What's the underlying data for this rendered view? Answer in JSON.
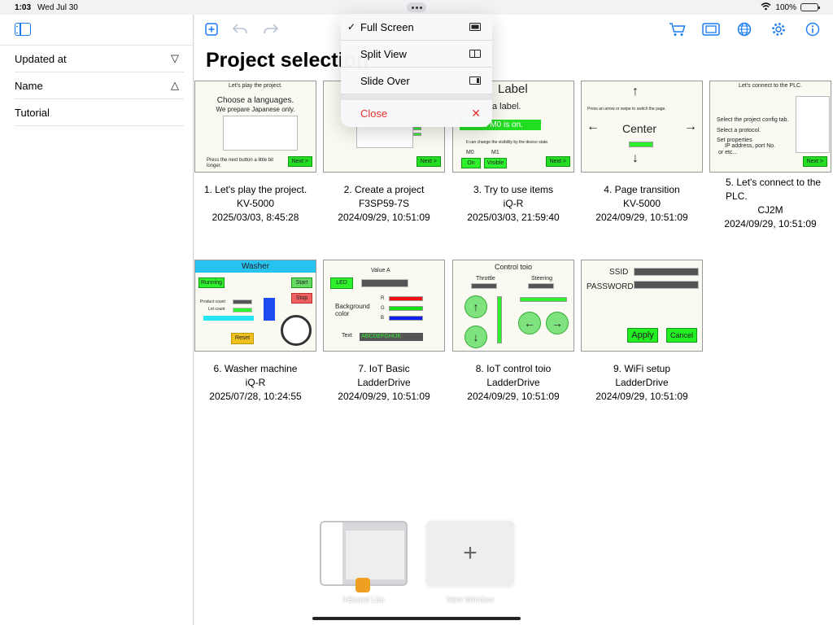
{
  "status": {
    "time": "1:03",
    "date": "Wed Jul 30",
    "battery": "100%",
    "battery_level": 1.0
  },
  "sidebar": {
    "sort_items": [
      {
        "label": "Updated at",
        "indicator": "▽"
      },
      {
        "label": "Name",
        "indicator": "△"
      },
      {
        "label": "Tutorial",
        "indicator": ""
      }
    ]
  },
  "toolbar": {
    "left_icons": [
      "add-icon",
      "undo-icon",
      "redo-icon"
    ],
    "right_icons": [
      "cart-icon",
      "ticket-icon",
      "globe-icon",
      "gear-icon",
      "info-icon"
    ]
  },
  "page": {
    "title": "Project selection"
  },
  "projects": [
    {
      "title": "1. Let's play the project.",
      "device": "KV-5000",
      "updated": "2025/03/03, 8:45:28",
      "thumb": {
        "header": "Let's play the project.",
        "line1": "Choose a languages.",
        "line2": "We prepare Japanese only.",
        "footer": "Press the next button a little bit longer.",
        "button": "Next >"
      }
    },
    {
      "title": "2. Create a project",
      "device": "F3SP59-7S",
      "updated": "2024/09/29, 10:51:09",
      "thumb": {
        "button": "Next >"
      }
    },
    {
      "title": "3. Try to use items",
      "device": "iQ-R",
      "updated": "2025/03/03, 21:59:40",
      "thumb": {
        "header": "Label",
        "line1": "a label.",
        "banner": "Device M0 is on.",
        "hint": "It can change the visibility by the device state.",
        "m0": "M0",
        "m1": "M1",
        "on": "On",
        "visible": "Visible",
        "button": "Next >"
      }
    },
    {
      "title": "4. Page transition",
      "device": "KV-5000",
      "updated": "2024/09/29, 10:51:09",
      "thumb": {
        "hint": "Press an arrow or swipe to switch the page.",
        "center": "Center"
      }
    },
    {
      "title": "5. Let's connect to the PLC.",
      "device": "CJ2M",
      "updated": "2024/09/29, 10:51:09",
      "thumb": {
        "header": "Let's connect to the PLC.",
        "line1": "Select the project config tab.",
        "line2": "Select a protocol.",
        "line3": "Set properties",
        "line4": "IP address, port No.",
        "line5": "or etc...",
        "button": "Next >"
      }
    },
    {
      "title": "6. Washer machine",
      "device": "iQ-R",
      "updated": "2025/07/28, 10:24:55",
      "thumb": {
        "header": "Washer",
        "running": "Running",
        "start": "Start",
        "stop": "Stop",
        "product": "Product count",
        "lot": "Lot count",
        "reset": "Reset"
      }
    },
    {
      "title": "7. IoT Basic",
      "device": "LadderDrive",
      "updated": "2024/09/29, 10:51:09",
      "thumb": {
        "value_a": "Value A",
        "led": "LED",
        "bg1": "Background",
        "bg2": "color",
        "r": "R",
        "g": "G",
        "b": "B",
        "text": "Text",
        "text_value": "ABCDEFGHIJK"
      }
    },
    {
      "title": "8. IoT control toio",
      "device": "LadderDrive",
      "updated": "2024/09/29, 10:51:09",
      "thumb": {
        "header": "Control toio",
        "throttle": "Throttle",
        "steering": "Steering"
      }
    },
    {
      "title": "9. WiFi setup",
      "device": "LadderDrive",
      "updated": "2024/09/29, 10:51:09",
      "thumb": {
        "ssid": "SSID",
        "password": "PASSWORD",
        "apply": "Apply",
        "cancel": "Cancel"
      }
    }
  ],
  "menu": {
    "items": [
      {
        "label": "Full Screen",
        "checked": "✓",
        "icon": "full-screen-icon"
      },
      {
        "label": "Split View",
        "checked": "",
        "icon": "split-view-icon"
      },
      {
        "label": "Slide Over",
        "checked": "",
        "icon": "slide-over-icon"
      }
    ],
    "close_label": "Close"
  },
  "shelf": {
    "app_window_label": "irBoard Lite",
    "new_window_label": "New Window",
    "new_window_symbol": "+"
  }
}
